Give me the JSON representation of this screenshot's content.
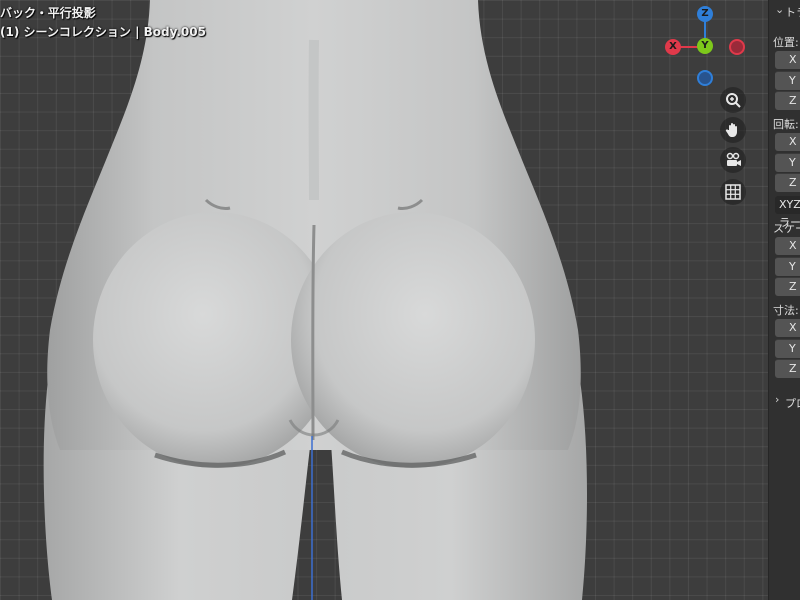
{
  "viewport": {
    "title": "バック・平行投影",
    "subtitle": "(1) シーンコレクション | Body.005",
    "gizmo": {
      "x": "X",
      "y": "Y",
      "z": "Z",
      "x_color": "#e0394a",
      "y_color": "#7dc81b",
      "z_color": "#2f7fd9"
    },
    "tools": {
      "zoom": "zoom-icon",
      "pan": "hand-icon",
      "camera": "camera-icon",
      "grid": "grid-icon"
    }
  },
  "panel": {
    "transform_header": "トランスフォーム",
    "location_label": "位置:",
    "rotation_label": "回転:",
    "rotation_mode": "XYZ オイラー角",
    "scale_label": "スケール:",
    "dimensions_label": "寸法:",
    "axis_x": "X",
    "axis_y": "Y",
    "axis_z": "Z",
    "properties_header": "プロパティ"
  }
}
